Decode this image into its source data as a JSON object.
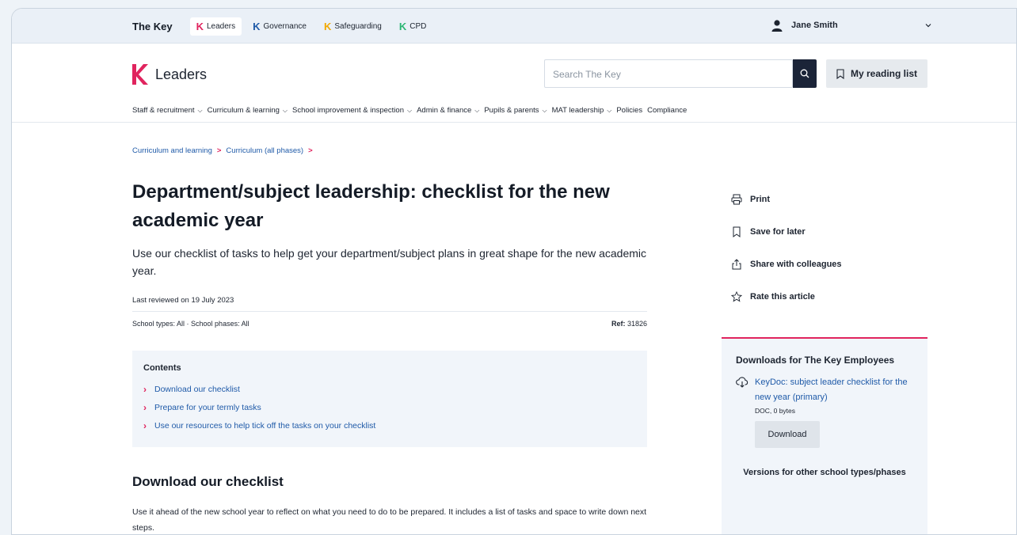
{
  "topbar": {
    "brand": "The Key",
    "products": [
      {
        "label": "Leaders",
        "color": "#e0245e"
      },
      {
        "label": "Governance",
        "color": "#1f5aa8"
      },
      {
        "label": "Safeguarding",
        "color": "#f2a900"
      },
      {
        "label": "CPD",
        "color": "#2bb673"
      }
    ],
    "user_name": "Jane Smith"
  },
  "header": {
    "logo_text": "Leaders",
    "search_placeholder": "Search The Key",
    "reading_list_label": "My reading list",
    "nav": [
      {
        "label": "Staff & recruitment",
        "dropdown": true
      },
      {
        "label": "Curriculum & learning",
        "dropdown": true
      },
      {
        "label": "School improvement & inspection",
        "dropdown": true
      },
      {
        "label": "Admin & finance",
        "dropdown": true
      },
      {
        "label": "Pupils & parents",
        "dropdown": true
      },
      {
        "label": "MAT leadership",
        "dropdown": true
      },
      {
        "label": "Policies",
        "dropdown": false
      },
      {
        "label": "Compliance",
        "dropdown": false
      }
    ]
  },
  "breadcrumb": [
    "Curriculum and learning",
    "Curriculum (all phases)"
  ],
  "article": {
    "title": "Department/subject leadership: checklist for the new academic year",
    "standfirst": "Use our checklist of tasks to help get your department/subject plans in great shape for the new academic year.",
    "reviewed": "Last reviewed on 19 July 2023",
    "meta_left": "School types: All · School phases: All",
    "ref_label": "Ref:",
    "ref_value": "31826",
    "contents_title": "Contents",
    "contents": [
      "Download our checklist",
      "Prepare for your termly tasks",
      "Use our resources to help tick off the tasks on your checklist"
    ],
    "section_heading": "Download our checklist",
    "section_text": "Use it ahead of the new school year to reflect on what you need to do to be prepared. It includes a list of tasks and space to write down next steps."
  },
  "actions": {
    "print": "Print",
    "save": "Save for later",
    "share": "Share with colleagues",
    "rate": "Rate this article"
  },
  "downloads": {
    "title": "Downloads for The Key Employees",
    "link": "KeyDoc: subject leader checklist for the new year (primary)",
    "file_meta": "DOC, 0 bytes",
    "button": "Download",
    "versions": "Versions for other school types/phases"
  },
  "colors": {
    "accent": "#e0245e",
    "link": "#1f5aa8",
    "search_button": "#1b2438"
  }
}
